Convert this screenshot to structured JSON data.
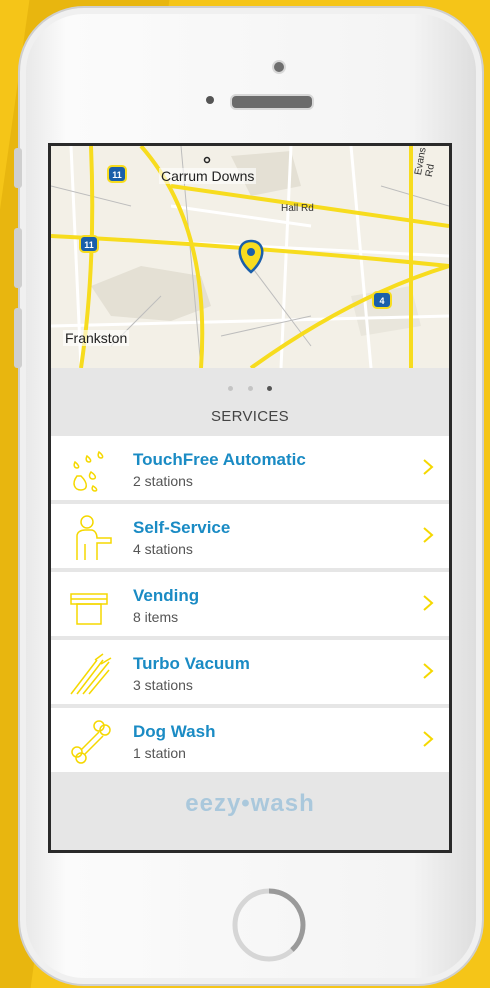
{
  "map": {
    "labels": {
      "carrum_downs": "Carrum Downs",
      "hall_rd": "Hall Rd",
      "evans_rd": "Evans Rd",
      "frankston": "Frankston"
    },
    "shields": [
      "11",
      "11",
      "4"
    ]
  },
  "pager": {
    "pages": 3,
    "active_index": 2
  },
  "services": {
    "heading": "SERVICES",
    "items": [
      {
        "title": "TouchFree Automatic",
        "subtitle": "2 stations",
        "icon": "water-drops-icon"
      },
      {
        "title": "Self-Service",
        "subtitle": "4 stations",
        "icon": "person-pointing-icon"
      },
      {
        "title": "Vending",
        "subtitle": "8 items",
        "icon": "vending-machine-icon"
      },
      {
        "title": "Turbo Vacuum",
        "subtitle": "3 stations",
        "icon": "vacuum-airflow-icon"
      },
      {
        "title": "Dog Wash",
        "subtitle": "1 station",
        "icon": "bone-icon"
      }
    ]
  },
  "brand": {
    "logo_text": "eezy•wash",
    "accent": "#f5d800",
    "link_color": "#1a8bc4"
  }
}
